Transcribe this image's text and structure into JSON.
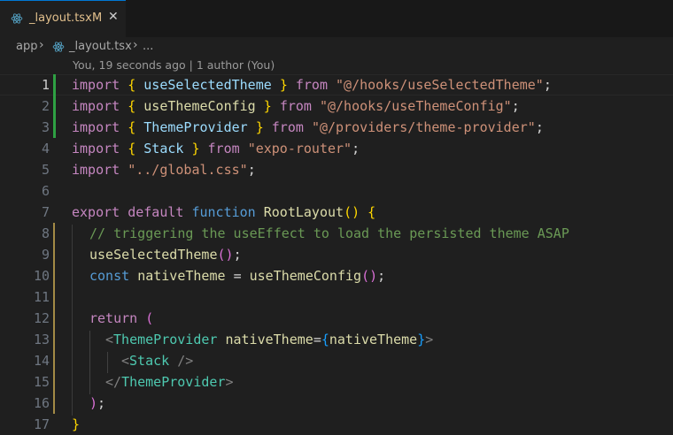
{
  "tab": {
    "title": "_layout.tsx",
    "modified": "M",
    "close": "✕"
  },
  "breadcrumb": {
    "folder": "app",
    "file": "_layout.tsx",
    "more": "..."
  },
  "blame": "You, 19 seconds ago | 1 author (You)",
  "line_numbers": [
    "1",
    "2",
    "3",
    "4",
    "5",
    "6",
    "7",
    "8",
    "9",
    "10",
    "11",
    "12",
    "13",
    "14",
    "15",
    "16",
    "17"
  ],
  "code": {
    "import": "import",
    "from": "from",
    "export": "export",
    "default": "default",
    "function": "function",
    "const": "const",
    "return": "return",
    "lbrace": "{",
    "rbrace": "}",
    "useSelectedTheme": "useSelectedTheme",
    "useThemeConfig": "useThemeConfig",
    "ThemeProvider": "ThemeProvider",
    "Stack": "Stack",
    "s1": "\"@/hooks/useSelectedTheme\"",
    "s2": "\"@/hooks/useThemeConfig\"",
    "s3": "\"@/providers/theme-provider\"",
    "s4": "\"expo-router\"",
    "s5": "\"../global.css\"",
    "semi": ";",
    "RootLayout": "RootLayout",
    "parens": "()",
    "comment": "// triggering the useEffect to load the persisted theme ASAP",
    "nativeTheme": "nativeTheme",
    "eq": "=",
    "lparen": "(",
    "rparen": ")",
    "lt": "<",
    "gt": ">",
    "selfclose": " />",
    "closeopen": "</",
    "attr": "nativeTheme",
    "paren_semi": ");"
  },
  "colors": {
    "keyword": "#c586c0",
    "storage": "#569cd6",
    "function": "#dcdcaa",
    "variable": "#9cdcfe",
    "string": "#ce9178",
    "comment": "#6a9955",
    "tag": "#4ec9b0",
    "git_added": "#2ea043"
  }
}
